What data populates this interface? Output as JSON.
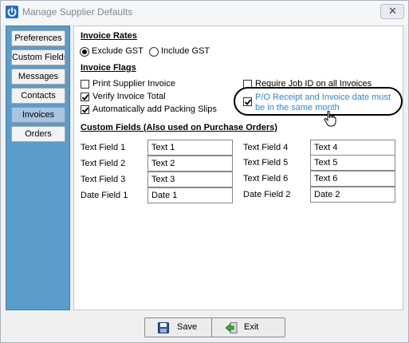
{
  "window": {
    "title": "Manage Supplier Defaults",
    "close_label": "✕"
  },
  "sidebar": {
    "items": [
      {
        "label": "Preferences",
        "active": false
      },
      {
        "label": "Custom Fields",
        "active": false
      },
      {
        "label": "Messages",
        "active": false
      },
      {
        "label": "Contacts",
        "active": false
      },
      {
        "label": "Invoices",
        "active": true
      },
      {
        "label": "Orders",
        "active": false
      }
    ]
  },
  "invoice_rates": {
    "title": "Invoice Rates",
    "exclude_label": "Exclude GST",
    "include_label": "Include GST",
    "selected": "Exclude GST"
  },
  "invoice_flags": {
    "title": "Invoice Flags",
    "print_supplier_invoice": {
      "label": "Print Supplier Invoice",
      "checked": false
    },
    "verify_invoice_total": {
      "label": "Verify Invoice Total",
      "checked": true
    },
    "auto_packing_slips": {
      "label": "Automatically add Packing Slips",
      "checked": true
    },
    "require_job_id": {
      "label": "Require Job ID on all Invoices",
      "checked": false
    },
    "po_receipt_same_month": {
      "label": "P/O Receipt and Invoice date must be in the same month",
      "checked": true
    }
  },
  "custom_fields": {
    "title": "Custom Fields (Also used on Purchase Orders)",
    "left": [
      {
        "label": "Text Field 1",
        "value": "Text 1"
      },
      {
        "label": "Text Field 2",
        "value": "Text 2"
      },
      {
        "label": "Text Field 3",
        "value": "Text 3"
      },
      {
        "label": "Date Field 1",
        "value": "Date 1"
      }
    ],
    "right": [
      {
        "label": "Text Field 4",
        "value": "Text 4"
      },
      {
        "label": "Text Field 5",
        "value": "Text 5"
      },
      {
        "label": "Text Field 6",
        "value": "Text 6"
      },
      {
        "label": "Date Field 2",
        "value": "Date 2"
      }
    ]
  },
  "footer": {
    "save_label": "Save",
    "exit_label": "Exit"
  },
  "colors": {
    "sidebar": "#5a9ccc",
    "accent_text": "#2b8ad6",
    "active_tab": "#a9c4de"
  },
  "icons": [
    "power-icon",
    "close-icon",
    "save-disk-icon",
    "exit-door-icon",
    "hand-cursor-icon",
    "checkmark-icon"
  ]
}
